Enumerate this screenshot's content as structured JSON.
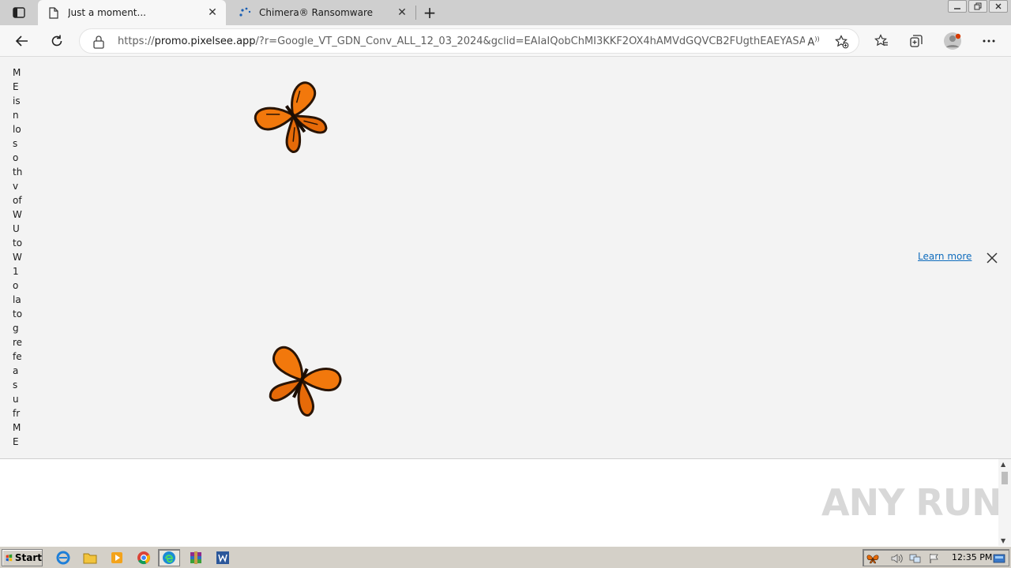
{
  "browser": {
    "tabs": [
      {
        "title": "Just a moment...",
        "active": true
      },
      {
        "title": "Chimera® Ransomware",
        "active": false
      }
    ],
    "address": {
      "scheme": "https://",
      "host": "promo.pixelsee.app",
      "rest": "/?r=Google_VT_GDN_Conv_ALL_12_03_2024&gclid=EAIaIQobChMI3KKF2OX4hAMVdGQVCB2FUgthEAEYASAA..."
    }
  },
  "page": {
    "vertical_text": [
      "M",
      "E",
      "is",
      "n",
      "lo",
      "s",
      "o",
      "th",
      "v",
      "of",
      "W",
      "U",
      "to",
      "W",
      "1",
      "o",
      "la",
      "to",
      "g",
      "re",
      "fe",
      "a",
      "s",
      "u",
      "fr",
      "M",
      "E"
    ],
    "learn_more": "Learn more",
    "watermark": "ANY RUN"
  },
  "taskbar": {
    "start_label": "Start",
    "clock": "12:35 PM"
  },
  "colors": {
    "link": "#0f6cbd",
    "butterfly": "#f2780c",
    "taskbar": "#d4d0c8"
  }
}
